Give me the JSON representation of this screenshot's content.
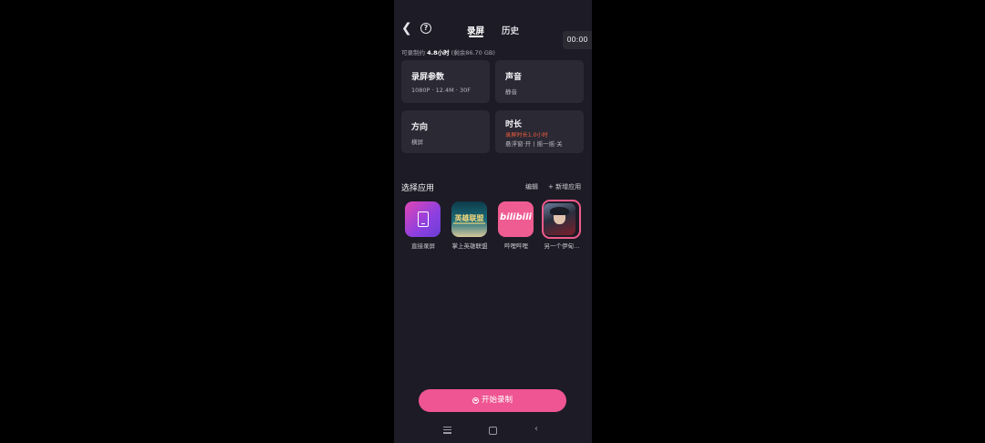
{
  "header": {
    "back_icon": "back-arrow-icon",
    "help_icon": "help-icon",
    "tabs": [
      {
        "label": "录屏",
        "active": true
      },
      {
        "label": "历史",
        "active": false
      }
    ],
    "timer": "00:00"
  },
  "capacity": {
    "prefix": "可录制约",
    "hours": "4.8小时",
    "remaining": "(剩余86.70 GB)"
  },
  "settings": {
    "params": {
      "title": "录屏参数",
      "value": "1080P · 12.4M · 30F"
    },
    "sound": {
      "title": "声音",
      "value": "静音"
    },
    "orientation": {
      "title": "方向",
      "value": "横屏"
    },
    "duration": {
      "title": "时长",
      "warning": "录屏时长1.0小时",
      "value": "悬浮窗·开丨摇一摇·关"
    }
  },
  "apps_section": {
    "title": "选择应用",
    "edit_label": "编辑",
    "add_label": "新增应用"
  },
  "apps": [
    {
      "label": "直接录屏",
      "icon": "screen-record-icon"
    },
    {
      "label": "掌上英雄联盟",
      "icon": "lol-app-icon",
      "logo_text": "英雄联盟"
    },
    {
      "label": "哔哩哔哩",
      "icon": "bilibili-app-icon",
      "logo_text": "bilibili"
    },
    {
      "label": "另一个伊甸…",
      "icon": "another-eden-app-icon",
      "selected": true
    }
  ],
  "start_button": {
    "label": "开始录制"
  },
  "colors": {
    "accent": "#ef5592",
    "warning": "#ef5a3c",
    "background": "#1d1b26",
    "card": "#2a2934"
  }
}
